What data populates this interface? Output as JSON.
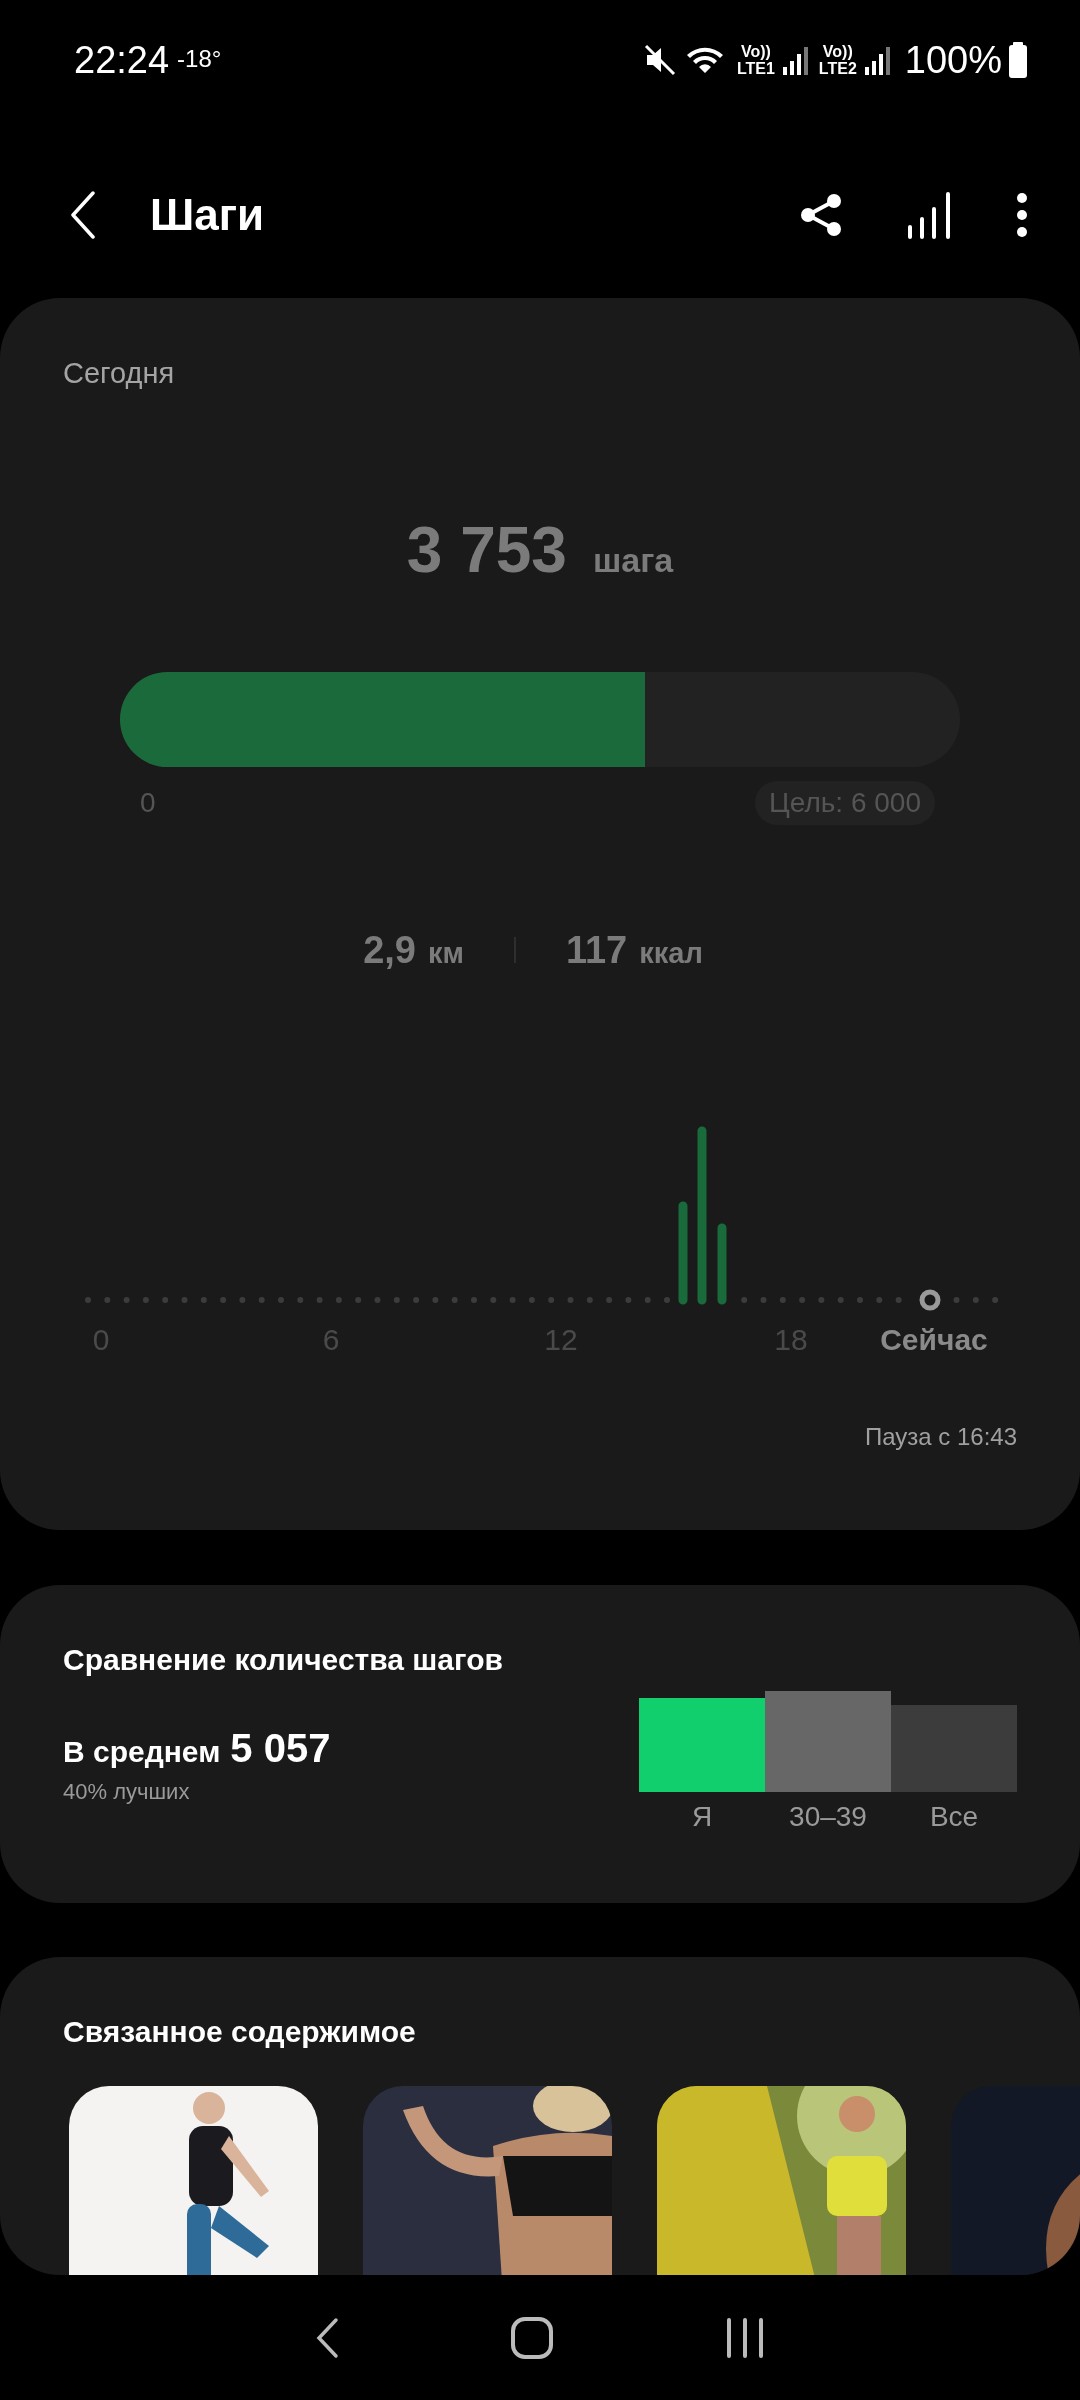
{
  "status_bar": {
    "time": "22:24",
    "temperature": "-18°",
    "sim1_top": "Vo))",
    "sim1_bottom": "LTE1",
    "sim2_top": "Vo))",
    "sim2_bottom": "LTE2",
    "battery": "100%"
  },
  "header": {
    "title": "Шаги"
  },
  "today": {
    "label": "Сегодня",
    "steps": "3 753",
    "steps_unit": "шага",
    "progress": {
      "level": 0.6255,
      "start": "0",
      "goal": "Цель: 6 000"
    },
    "distance_value": "2,9",
    "distance_unit": "км",
    "calories_value": "117",
    "calories_unit": "ккал",
    "chart": {
      "x_labels": [
        "0",
        "6",
        "12",
        "18"
      ],
      "now_label": "Сейчас"
    },
    "pause": "Пауза с 16:43"
  },
  "comparison": {
    "title": "Сравнение количества шагов",
    "average_label": "В среднем",
    "average_value": "5 057",
    "rank": "40% лучших",
    "groups": [
      {
        "label": "Я",
        "color": "#12cf6d"
      },
      {
        "label": "30–39",
        "color": "#676767"
      },
      {
        "label": "Все",
        "color": "#3c3c3c"
      }
    ]
  },
  "related": {
    "title": "Связанное содержимое"
  }
}
